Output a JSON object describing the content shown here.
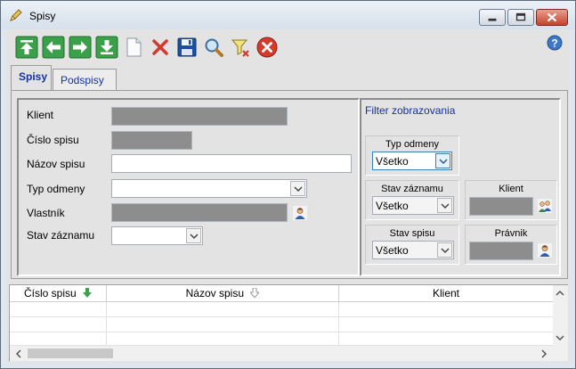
{
  "window": {
    "title": "Spisy"
  },
  "toolbar": {
    "buttons": [
      {
        "name": "first-record",
        "icon": "arrow-up-to-top-icon"
      },
      {
        "name": "previous-record",
        "icon": "arrow-left-icon"
      },
      {
        "name": "next-record",
        "icon": "arrow-right-icon"
      },
      {
        "name": "last-record",
        "icon": "arrow-down-to-bottom-icon"
      },
      {
        "name": "new-record",
        "icon": "new-document-icon"
      },
      {
        "name": "delete-record",
        "icon": "delete-x-icon"
      },
      {
        "name": "save-record",
        "icon": "floppy-disk-icon"
      },
      {
        "name": "search",
        "icon": "magnifier-icon"
      },
      {
        "name": "clear-filter",
        "icon": "filter-clear-icon"
      },
      {
        "name": "close",
        "icon": "close-circle-icon"
      }
    ]
  },
  "tabs": [
    {
      "label": "Spisy",
      "active": true
    },
    {
      "label": "Podspisy",
      "active": false
    }
  ],
  "form": {
    "klient_label": "Klient",
    "cislo_label": "Číslo spisu",
    "nazov_label": "Názov spisu",
    "typ_label": "Typ odmeny",
    "vlastnik_label": "Vlastník",
    "stav_label": "Stav záznamu",
    "nazov_value": "",
    "typ_value": "",
    "stav_value": ""
  },
  "filter": {
    "title": "Filter zobrazovania",
    "typ_odmeny_label": "Typ odmeny",
    "typ_odmeny_value": "Všetko",
    "stav_zaznamu_label": "Stav záznamu",
    "stav_zaznamu_value": "Všetko",
    "stav_spisu_label": "Stav spisu",
    "stav_spisu_value": "Všetko",
    "klient_label": "Klient",
    "pravnik_label": "Právnik"
  },
  "grid": {
    "columns": [
      {
        "label": "Číslo spisu",
        "sort": "desc-active"
      },
      {
        "label": "Názov spisu",
        "sort": "desc-inactive"
      },
      {
        "label": "Klient",
        "sort": "none"
      }
    ],
    "rows": [
      [],
      [],
      []
    ]
  },
  "colors": {
    "accent_blue": "#15339a",
    "disabled_field": "#8d8d8d",
    "close_red": "#c5432d"
  }
}
